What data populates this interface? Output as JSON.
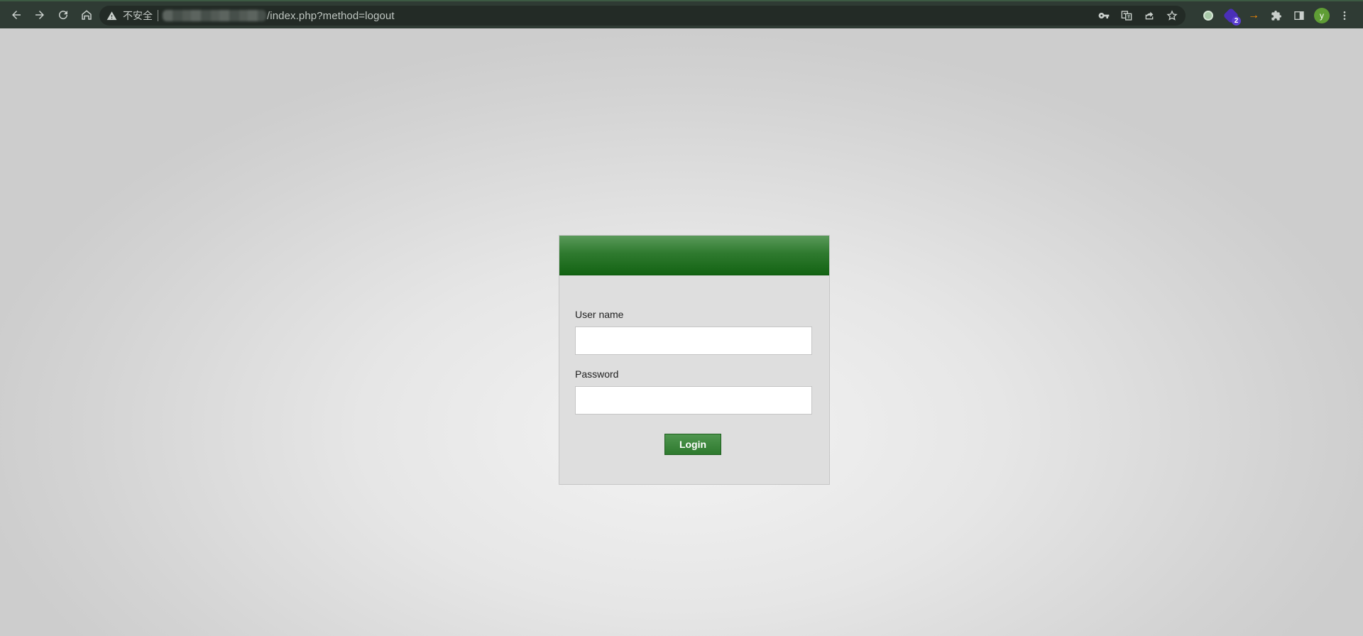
{
  "browser": {
    "security_label": "不安全",
    "url_path": "/index.php?method=logout",
    "extensions": {
      "badge_count": "2",
      "arrow_glyph": "→",
      "profile_initial": "y"
    },
    "icons": [
      "back-icon",
      "forward-icon",
      "reload-icon",
      "home-icon",
      "warning-icon",
      "key-icon",
      "translate-icon",
      "share-icon",
      "star-icon",
      "puzzle-icon",
      "sidebar-icon",
      "more-icon"
    ]
  },
  "login": {
    "username_label": "User name",
    "username_value": "",
    "password_label": "Password",
    "password_value": "",
    "submit_label": "Login"
  },
  "colors": {
    "header_green": "#136313",
    "button_green": "#2e7a2e",
    "chrome_bg": "#2f3b34"
  }
}
